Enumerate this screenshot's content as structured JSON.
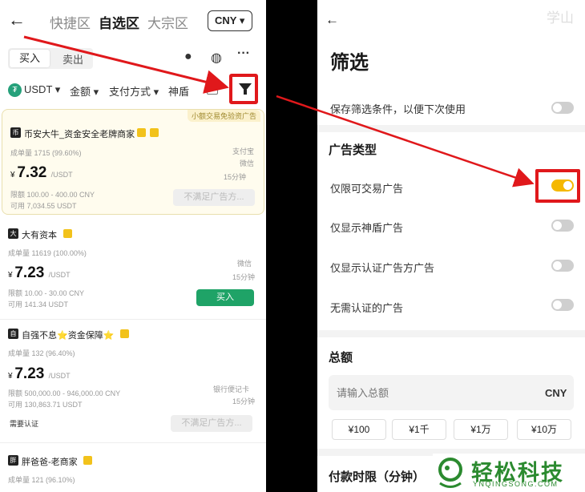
{
  "left": {
    "nav": {
      "back_icon": "back-arrow-icon",
      "tabs": [
        "快捷区",
        "自选区",
        "大宗区"
      ],
      "active_tab": "自选区",
      "currency": "CNY ▾"
    },
    "side": {
      "buy": "买入",
      "sell": "卖出"
    },
    "icons": [
      "notification-icon",
      "order-icon",
      "more-icon"
    ],
    "filters": {
      "coin": "USDT ▾",
      "amount": "金额 ▾",
      "payment": "支付方式 ▾",
      "shield": "神盾"
    },
    "cards": [
      {
        "promo": "小额交易免验资广告",
        "name": "币安大牛_资金安全老牌商家",
        "stats": "成单量 1715 (99.60%)",
        "price": "7.32",
        "unit": "/USDT",
        "limit": "限额 100.00 - 400.00 CNY",
        "available": "可用 7,034.55 USDT",
        "pay1": "支付宝",
        "pay2": "微信",
        "time": "15分钟",
        "button": "不满足广告方..."
      },
      {
        "name": "大有资本",
        "stats": "成单量 11619 (100.00%)",
        "price": "7.23",
        "unit": "/USDT",
        "limit": "限额 10.00 - 30.00 CNY",
        "available": "可用 141.34 USDT",
        "pay1": "微信",
        "time": "15分钟",
        "button": "买入"
      },
      {
        "name": "自强不息⭐资金保障⭐",
        "stats": "成单量 132 (96.40%)",
        "price": "7.23",
        "unit": "/USDT",
        "limit": "限额 500,000.00 - 946,000.00 CNY",
        "available": "可用 130,863.71 USDT",
        "pay1": "银行便记卡",
        "time": "15分钟",
        "verify": "需要认证",
        "button": "不满足广告方..."
      },
      {
        "name": "胖爸爸-老商家",
        "stats": "成单量 121 (96.10%)"
      }
    ]
  },
  "right": {
    "back_icon": "back-arrow-icon",
    "title": "筛选",
    "save_filter": "保存筛选条件，以便下次使用",
    "ad_type_heading": "广告类型",
    "options": [
      {
        "label": "仅限可交易广告",
        "on": true
      },
      {
        "label": "仅显示神盾广告",
        "on": false
      },
      {
        "label": "仅显示认证广告方广告",
        "on": false
      },
      {
        "label": "无需认证的广告",
        "on": false
      }
    ],
    "amount_heading": "总额",
    "amount_placeholder": "请输入总额",
    "amount_currency": "CNY",
    "quick_amounts": [
      "¥100",
      "¥1千",
      "¥1万",
      "¥10万"
    ],
    "payment_time_heading": "付款时限（分钟）",
    "watermark": "学山"
  },
  "logo": {
    "name": "轻松科技",
    "domain": "YNQINGSONG.COM"
  },
  "colors": {
    "accent_red": "#e0181b",
    "toggle_on": "#f5b800",
    "buy_green": "#1fa367",
    "logo_green": "#2b8a2f"
  }
}
